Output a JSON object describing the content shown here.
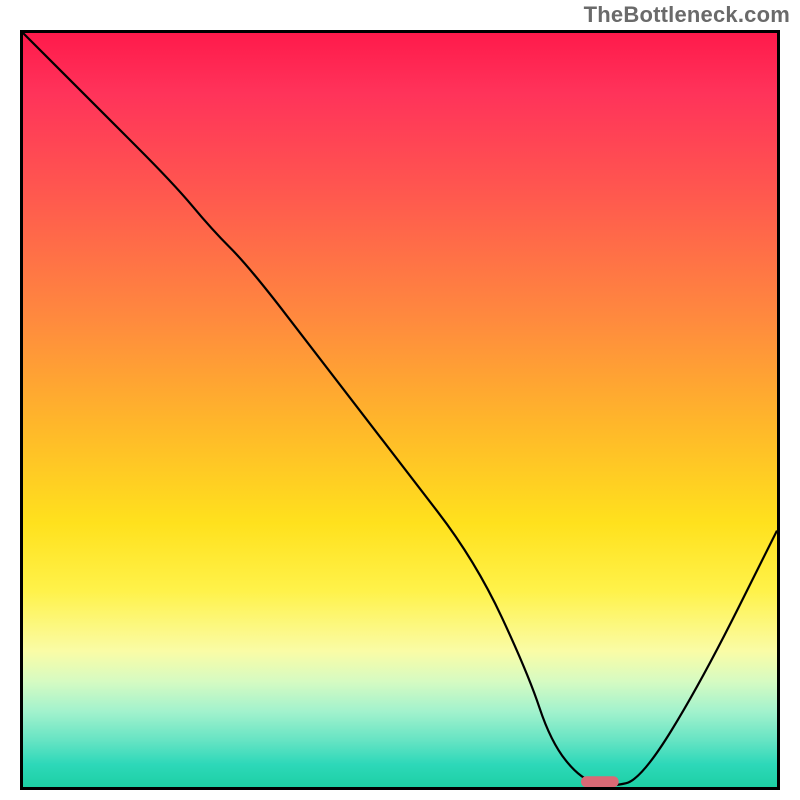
{
  "watermark": "TheBottleneck.com",
  "chart_data": {
    "type": "line",
    "title": "",
    "xlabel": "",
    "ylabel": "",
    "xlim": [
      0,
      100
    ],
    "ylim": [
      0,
      100
    ],
    "grid": false,
    "legend": false,
    "annotations": [],
    "background": "vertical-heat-gradient",
    "series": [
      {
        "name": "bottleneck-curve",
        "x": [
          0,
          10,
          20,
          25,
          30,
          40,
          50,
          60,
          67,
          70,
          74,
          78,
          82,
          90,
          100
        ],
        "y": [
          100,
          90,
          80,
          74,
          69,
          56,
          43,
          30,
          15,
          6,
          1,
          0,
          1,
          14,
          34
        ]
      }
    ],
    "marker": {
      "name": "optimal-range",
      "x_center": 76.5,
      "width": 5,
      "y": 0.7,
      "shape": "rounded-bar",
      "color": "#d96a75"
    },
    "gradient_stops": [
      {
        "pos": 0,
        "color": "#ff1a4b"
      },
      {
        "pos": 22,
        "color": "#ff5a4e"
      },
      {
        "pos": 38,
        "color": "#ff8a3e"
      },
      {
        "pos": 52,
        "color": "#ffb72a"
      },
      {
        "pos": 65,
        "color": "#ffe11d"
      },
      {
        "pos": 82,
        "color": "#fafca6"
      },
      {
        "pos": 90,
        "color": "#a2f2cd"
      },
      {
        "pos": 100,
        "color": "#1dd0a4"
      }
    ]
  }
}
